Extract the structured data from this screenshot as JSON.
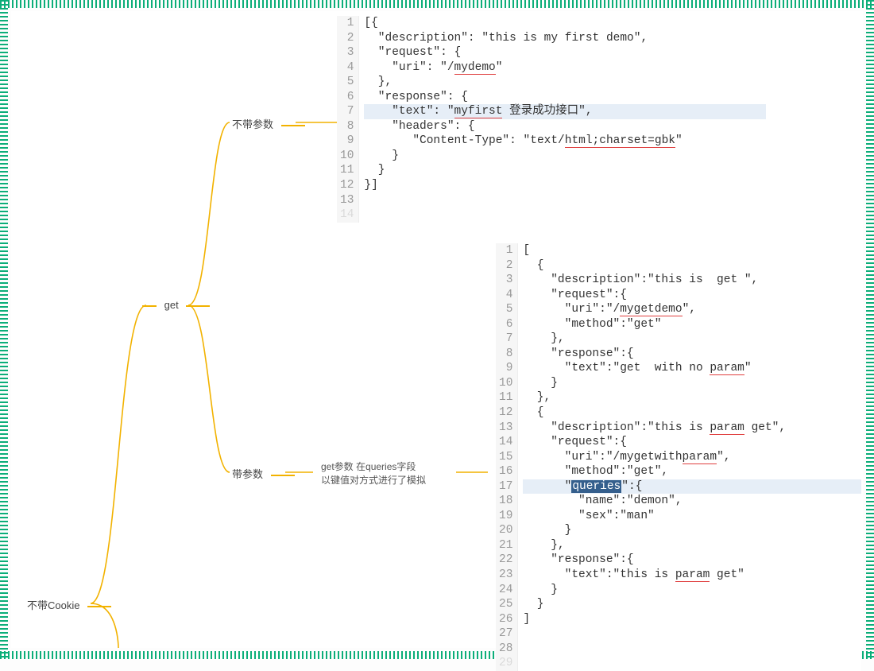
{
  "nodes": {
    "root": "不带Cookie",
    "get": "get",
    "noparam": "不带参数",
    "withparam": "带参数",
    "queries_note_line1": "get参数 在queries字段",
    "queries_note_line2": "以键值对方式进行了模拟"
  },
  "code1": {
    "start": 1,
    "highlight": [
      8
    ],
    "lines": [
      "[{",
      "  \"description\": \"this is my first demo\",",
      "  \"request\": {",
      "    \"uri\": \"/mydemo\"",
      "",
      "  },",
      "  \"response\": {",
      "    \"text\": \"myfirst 登录成功接口\",",
      "    \"headers\": {",
      "       \"Content-Type\": \"text/html;charset=gbk\"",
      "    }",
      "  }",
      "}]"
    ]
  },
  "code2": {
    "start": 1,
    "highlight": [
      18
    ],
    "lines": [
      "[",
      "  {",
      "    \"description\":\"this is  get \",",
      "    \"request\":{",
      "      \"uri\":\"/mygetdemo\",",
      "      \"method\":\"get\"",
      "    },",
      "    \"response\":{",
      "      \"text\":\"get  with no param\"",
      "    }",
      "",
      "  },",
      "  {",
      "    \"description\":\"this is param get\",",
      "    \"request\":{",
      "      \"uri\":\"/mygetwithparam\",",
      "      \"method\":\"get\",",
      "      \"queries\":{",
      "        \"name\":\"demon\",",
      "        \"sex\":\"man\"",
      "      }",
      "    },",
      "    \"response\":{",
      "      \"text\":\"this is param get\"",
      "    }",
      "",
      "  }",
      "]"
    ]
  },
  "underline_tokens": [
    "mydemo",
    "myfirst",
    "html;charset=gbk",
    "mygetdemo",
    "param",
    "mygetwithparam",
    "param",
    "param"
  ],
  "selection_token": "queries"
}
